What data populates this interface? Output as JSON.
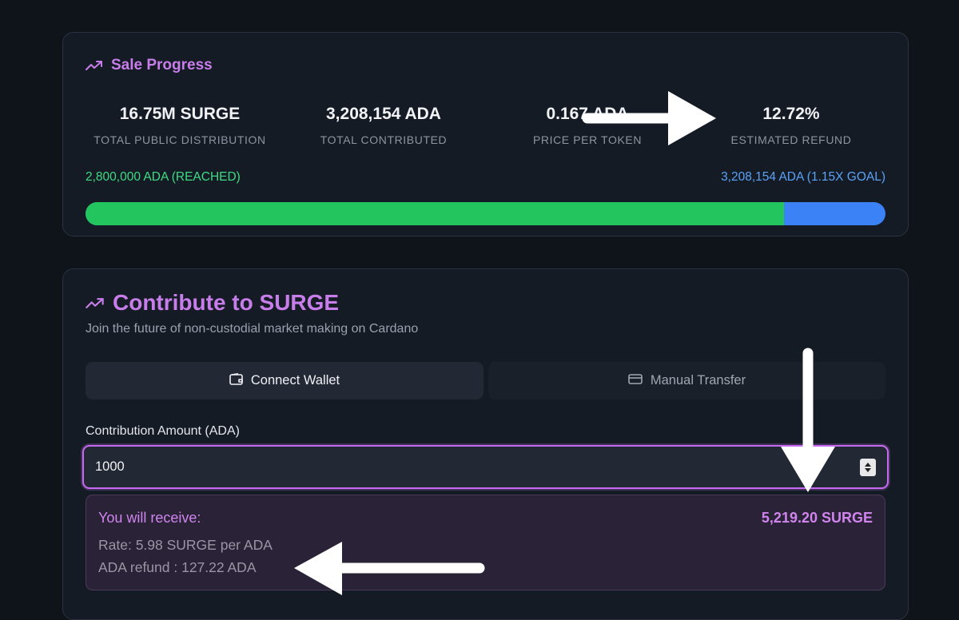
{
  "sale": {
    "title": "Sale Progress",
    "icon": "trending-up-icon",
    "stats": [
      {
        "value": "16.75M SURGE",
        "label": "TOTAL PUBLIC DISTRIBUTION"
      },
      {
        "value": "3,208,154 ADA",
        "label": "TOTAL CONTRIBUTED"
      },
      {
        "value": "0.167 ADA",
        "label": "PRICE PER TOKEN"
      },
      {
        "value": "12.72%",
        "label": "ESTIMATED REFUND"
      }
    ],
    "goal_reached": "2,800,000 ADA (REACHED)",
    "total_goal": "3,208,154 ADA (1.15X GOAL)",
    "progress_fraction": 0.873,
    "colors": {
      "accent": "#c77dea",
      "reached": "#22c55e",
      "over": "#3b82f6"
    }
  },
  "contribute": {
    "title": "Contribute to SURGE",
    "subtitle": "Join the future of non-custodial market making on Cardano",
    "tabs": [
      {
        "label": "Connect Wallet",
        "icon": "wallet-icon",
        "active": true
      },
      {
        "label": "Manual Transfer",
        "icon": "credit-card-icon",
        "active": false
      }
    ],
    "amount_label": "Contribution Amount (ADA)",
    "amount_value": "1000",
    "receive": {
      "label": "You will receive:",
      "amount": "5,219.20 SURGE",
      "rate": "Rate: 5.98 SURGE per ADA",
      "refund": "ADA refund : 127.22 ADA"
    }
  }
}
